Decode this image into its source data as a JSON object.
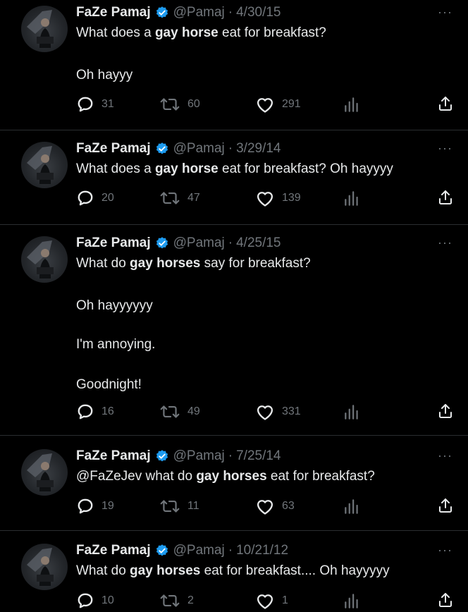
{
  "tweets": [
    {
      "name": "FaZe Pamaj",
      "handle": "@Pamaj",
      "separator": "·",
      "date": "4/30/15",
      "lines": [
        {
          "parts": [
            {
              "t": "What does a ",
              "b": false
            },
            {
              "t": "gay horse",
              "b": true
            },
            {
              "t": " eat for breakfast?",
              "b": false
            }
          ]
        },
        {
          "parts": [
            {
              "t": "Oh hayyy",
              "b": false
            }
          ]
        }
      ],
      "replies": "31",
      "retweets": "60",
      "likes": "291"
    },
    {
      "name": "FaZe Pamaj",
      "handle": "@Pamaj",
      "separator": "·",
      "date": "3/29/14",
      "lines": [
        {
          "parts": [
            {
              "t": "What does a ",
              "b": false
            },
            {
              "t": "gay horse",
              "b": true
            },
            {
              "t": " eat for breakfast? Oh hayyyy",
              "b": false
            }
          ]
        }
      ],
      "replies": "20",
      "retweets": "47",
      "likes": "139"
    },
    {
      "name": "FaZe Pamaj",
      "handle": "@Pamaj",
      "separator": "·",
      "date": "4/25/15",
      "lines": [
        {
          "parts": [
            {
              "t": "What do ",
              "b": false
            },
            {
              "t": "gay horses",
              "b": true
            },
            {
              "t": " say for breakfast?",
              "b": false
            }
          ]
        },
        {
          "parts": [
            {
              "t": "Oh hayyyyyy",
              "b": false
            }
          ]
        },
        {
          "parts": [
            {
              "t": "I'm annoying.",
              "b": false
            }
          ]
        },
        {
          "parts": [
            {
              "t": "Goodnight!",
              "b": false
            }
          ]
        }
      ],
      "replies": "16",
      "retweets": "49",
      "likes": "331"
    },
    {
      "name": "FaZe Pamaj",
      "handle": "@Pamaj",
      "separator": "·",
      "date": "7/25/14",
      "lines": [
        {
          "parts": [
            {
              "t": "@FaZeJev what do ",
              "b": false
            },
            {
              "t": "gay horses",
              "b": true
            },
            {
              "t": " eat for breakfast?",
              "b": false
            }
          ]
        }
      ],
      "replies": "19",
      "retweets": "11",
      "likes": "63"
    },
    {
      "name": "FaZe Pamaj",
      "handle": "@Pamaj",
      "separator": "·",
      "date": "10/21/12",
      "lines": [
        {
          "parts": [
            {
              "t": "What do ",
              "b": false
            },
            {
              "t": "gay horses",
              "b": true
            },
            {
              "t": " eat for breakfast.... Oh hayyyyy",
              "b": false
            }
          ]
        }
      ],
      "replies": "10",
      "retweets": "2",
      "likes": "1"
    }
  ],
  "icons": {
    "more": "more-options-icon",
    "verified": "verified-badge-icon",
    "reply": "reply-icon",
    "retweet": "retweet-icon",
    "like": "heart-icon",
    "views": "views-chart-icon",
    "share": "share-icon"
  },
  "colors": {
    "background": "#000000",
    "text": "#e7e9ea",
    "secondary": "#71767b",
    "verified": "#1d9bf0",
    "divider": "#2a2d30"
  }
}
